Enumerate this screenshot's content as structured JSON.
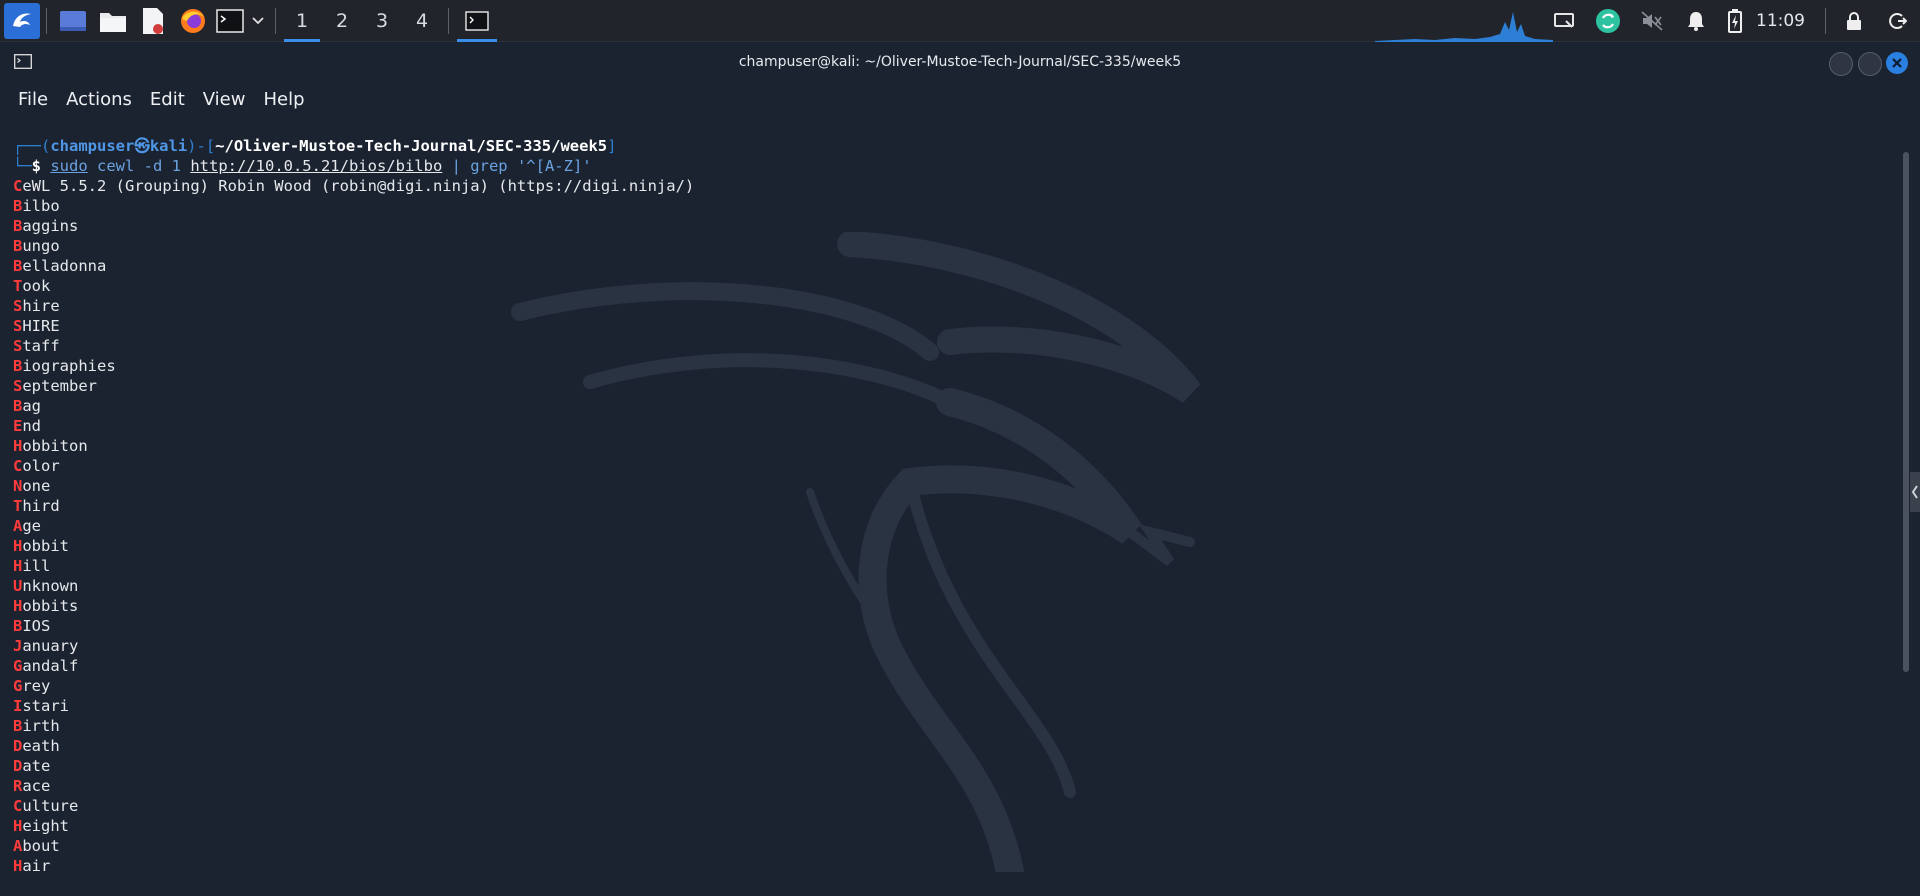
{
  "panel": {
    "workspaces": [
      "1",
      "2",
      "3",
      "4"
    ],
    "active_workspace": "1",
    "clock": "11:09",
    "accent": "#3b8eea"
  },
  "window": {
    "title": "champuser@kali: ~/Oliver-Mustoe-Tech-Journal/SEC-335/week5",
    "menu": [
      "File",
      "Actions",
      "Edit",
      "View",
      "Help"
    ]
  },
  "terminal": {
    "prompt_open": "┌──(",
    "user": "champuser",
    "at": "㉿",
    "host": "kali",
    "prompt_mid": ")-[",
    "cwd": "~/Oliver-Mustoe-Tech-Journal/SEC-335/week5",
    "prompt_close": "]",
    "prompt_second": "└─",
    "dollar": "$ ",
    "cmd_sudo": "sudo",
    "cmd_cewl": " cewl -d 1 ",
    "cmd_url": "http://10.0.5.21/bios/bilbo",
    "cmd_pipe": " | ",
    "cmd_grep": "grep",
    "cmd_pattern": " '^[A-Z]'",
    "banner": "CeWL 5.5.2 (Grouping) Robin Wood (robin@digi.ninja) (https://digi.ninja/)",
    "words": [
      "Bilbo",
      "Baggins",
      "Bungo",
      "Belladonna",
      "Took",
      "Shire",
      "SHIRE",
      "Staff",
      "Biographies",
      "September",
      "Bag",
      "End",
      "Hobbiton",
      "Color",
      "None",
      "Third",
      "Age",
      "Hobbit",
      "Hill",
      "Unknown",
      "Hobbits",
      "BIOS",
      "January",
      "Gandalf",
      "Grey",
      "Istari",
      "Birth",
      "Death",
      "Date",
      "Race",
      "Culture",
      "Height",
      "About",
      "Hair"
    ]
  }
}
